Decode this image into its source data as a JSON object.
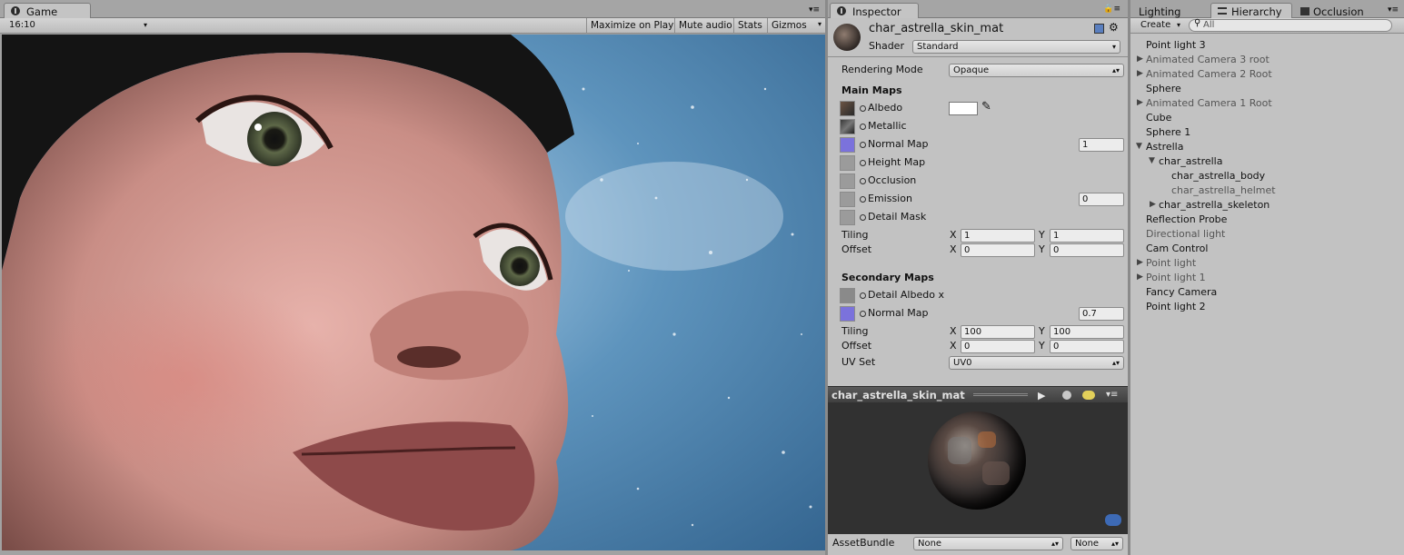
{
  "game": {
    "tab_label": "Game",
    "aspect": "16:10",
    "maximize_label": "Maximize on Play",
    "mute_label": "Mute audio",
    "stats_label": "Stats",
    "gizmos_label": "Gizmos"
  },
  "inspector": {
    "tab_label": "Inspector",
    "material_name": "char_astrella_skin_mat",
    "shader_label": "Shader",
    "shader_value": "Standard",
    "rendering_mode_label": "Rendering Mode",
    "rendering_mode_value": "Opaque",
    "main_maps_label": "Main Maps",
    "main_maps": {
      "albedo": "Albedo",
      "metallic": "Metallic",
      "normal_map": "Normal Map",
      "normal_map_value": "1",
      "height_map": "Height Map",
      "occlusion": "Occlusion",
      "emission": "Emission",
      "emission_value": "0",
      "detail_mask": "Detail Mask"
    },
    "tiling_label": "Tiling",
    "offset_label": "Offset",
    "x_label": "X",
    "y_label": "Y",
    "main_tiling": {
      "x": "1",
      "y": "1"
    },
    "main_offset": {
      "x": "0",
      "y": "0"
    },
    "secondary_maps_label": "Secondary Maps",
    "secondary_maps": {
      "detail_albedo": "Detail Albedo x",
      "normal_map": "Normal Map",
      "normal_map_value": "0.7"
    },
    "secondary_tiling": {
      "x": "100",
      "y": "100"
    },
    "secondary_offset": {
      "x": "0",
      "y": "0"
    },
    "uv_set_label": "UV Set",
    "uv_set_value": "UV0",
    "preview_title": "char_astrella_skin_mat",
    "assetbundle_label": "AssetBundle",
    "assetbundle_value": "None",
    "assetbundle_variant": "None"
  },
  "right": {
    "lighting_tab": "Lighting",
    "hierarchy_tab": "Hierarchy",
    "occlusion_tab": "Occlusion",
    "create_label": "Create",
    "search_placeholder": "All",
    "items": [
      {
        "label": "Point light 3"
      },
      {
        "label": "Animated Camera 3 root"
      },
      {
        "label": "Animated Camera 2 Root"
      },
      {
        "label": "Sphere"
      },
      {
        "label": "Animated Camera 1 Root"
      },
      {
        "label": "Cube"
      },
      {
        "label": "Sphere 1"
      },
      {
        "label": "Astrella"
      },
      {
        "label": "char_astrella"
      },
      {
        "label": "char_astrella_body"
      },
      {
        "label": "char_astrella_helmet"
      },
      {
        "label": "char_astrella_skeleton"
      },
      {
        "label": "Reflection Probe"
      },
      {
        "label": "Directional light"
      },
      {
        "label": "Cam Control"
      },
      {
        "label": "Point light"
      },
      {
        "label": "Point light 1"
      },
      {
        "label": "Fancy Camera"
      },
      {
        "label": "Point light 2"
      }
    ]
  },
  "colors": {
    "normal_map_swatch": "#7b72dc",
    "albedo_color": "#ffffff",
    "selection_blue": "#3d6ab5"
  }
}
